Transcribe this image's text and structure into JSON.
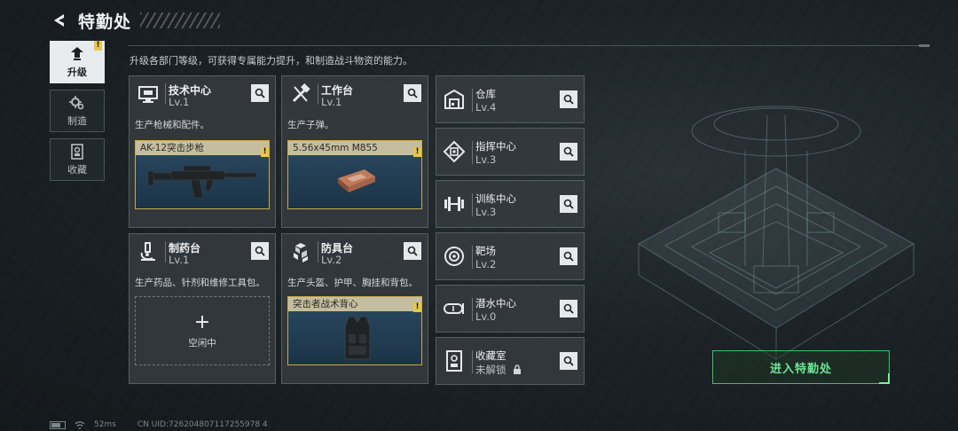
{
  "header": {
    "title": "特勤处"
  },
  "subtitle": "升级各部门等级，可获得专属能力提升，和制造战斗物资的能力。",
  "side_tabs": [
    {
      "label": "升级",
      "icon": "upgrade-icon",
      "active": true
    },
    {
      "label": "制造",
      "icon": "gears-icon",
      "active": false
    },
    {
      "label": "收藏",
      "icon": "collection-icon",
      "active": false
    }
  ],
  "workshops": [
    {
      "name": "技术中心",
      "level": "Lv.1",
      "desc": "生产枪械和配件。",
      "slot_label": "AK-12突击步枪",
      "icon": "monitor-icon"
    },
    {
      "name": "工作台",
      "level": "Lv.1",
      "desc": "生产子弹。",
      "slot_label": "5.56x45mm M855",
      "icon": "tools-icon"
    },
    {
      "name": "制药台",
      "level": "Lv.1",
      "desc": "生产药品、针剂和维修工具包。",
      "slot_empty_label": "空闲中",
      "icon": "microscope-icon"
    },
    {
      "name": "防具台",
      "level": "Lv.2",
      "desc": "生产头盔、护甲、胸挂和背包。",
      "slot_label": "突击者战术背心",
      "icon": "armor-blocks-icon"
    }
  ],
  "facilities": [
    {
      "name": "仓库",
      "level": "Lv.4",
      "icon": "warehouse-icon"
    },
    {
      "name": "指挥中心",
      "level": "Lv.3",
      "icon": "command-chip-icon"
    },
    {
      "name": "训练中心",
      "level": "Lv.3",
      "icon": "dumbbell-icon"
    },
    {
      "name": "靶场",
      "level": "Lv.2",
      "icon": "target-icon"
    },
    {
      "name": "潜水中心",
      "level": "Lv.0",
      "icon": "diving-mask-icon"
    },
    {
      "name": "收藏室",
      "level": "未解锁",
      "icon": "collection-room-icon"
    }
  ],
  "enter_button": "进入特勤处",
  "status": {
    "ping": "52ms",
    "uid": "CN UID:726204807117255978 4"
  },
  "colors": {
    "accent_green": "#3fbf6a",
    "warning_yellow": "#e5c84a",
    "slot_gold": "#c9a94e"
  }
}
